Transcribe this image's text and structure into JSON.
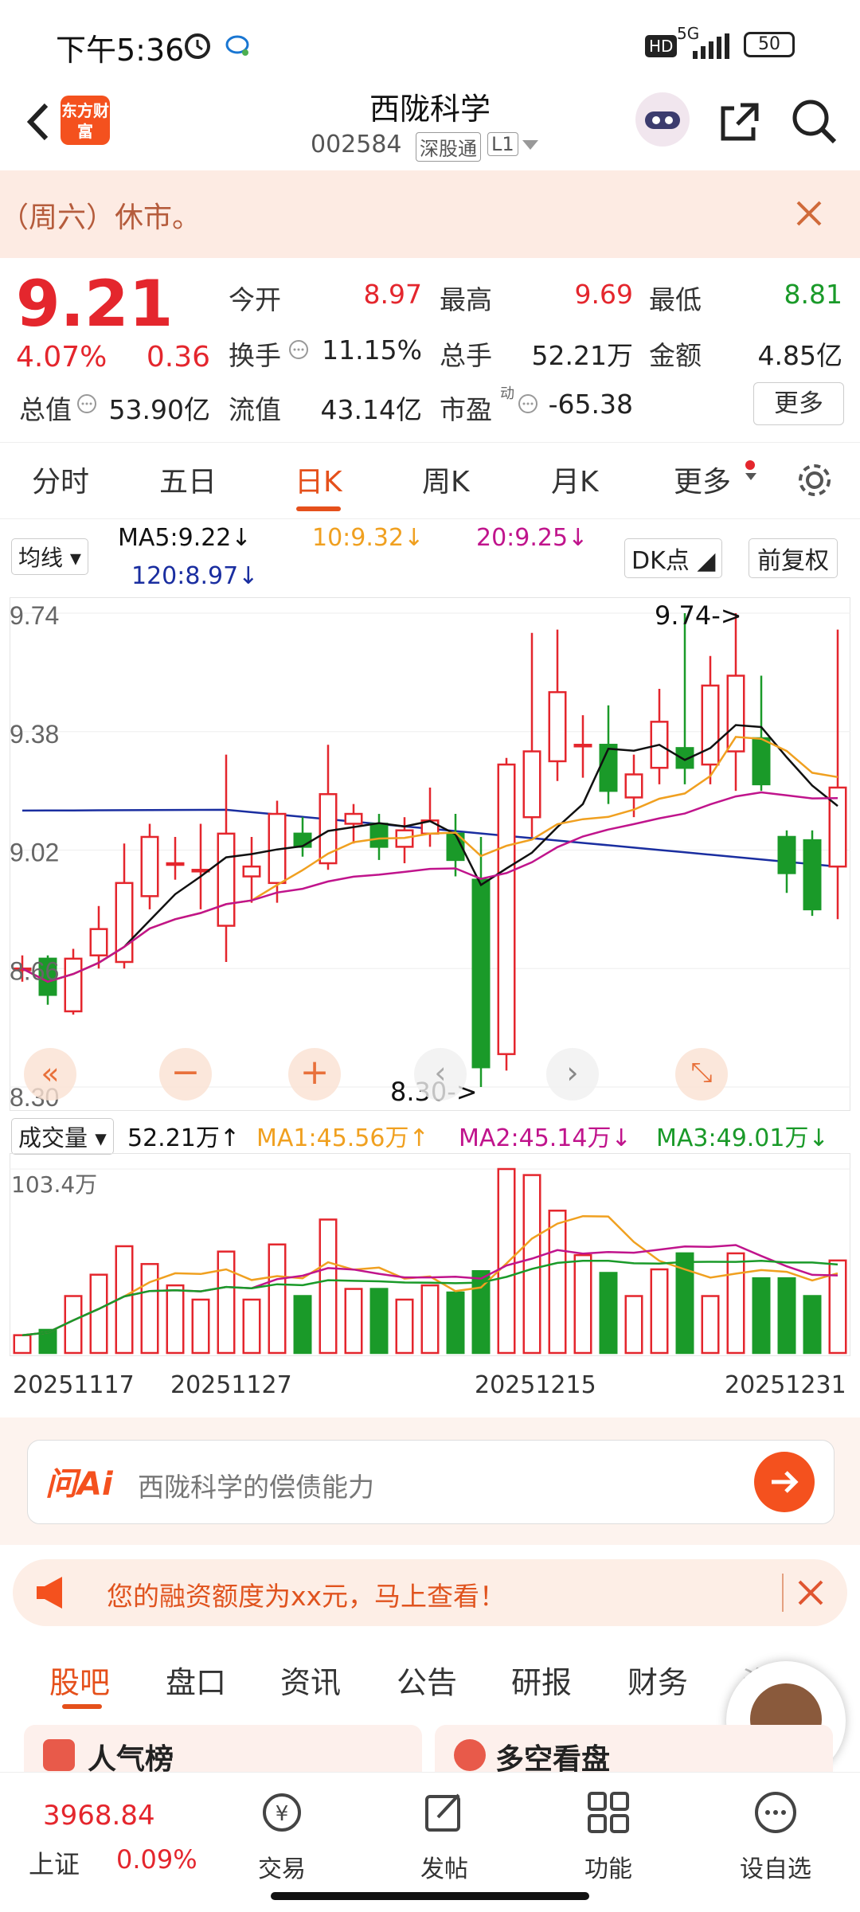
{
  "status_bar": {
    "time": "下午5:36",
    "network": "5G",
    "battery": "50",
    "hd": "HD"
  },
  "header": {
    "logo_text": "东方财富",
    "stock_name": "西陇科学",
    "stock_code": "002584",
    "tag1": "深股通",
    "tag2": "L1"
  },
  "notice": {
    "text": "（周六）休市。"
  },
  "quote": {
    "price": "9.21",
    "change_pct": "4.07%",
    "change_amt": "0.36",
    "open_label": "今开",
    "open": "8.97",
    "high_label": "最高",
    "high": "9.69",
    "low_label": "最低",
    "low": "8.81",
    "turnover_label": "换手",
    "turnover": "11.15%",
    "volume_label": "总手",
    "volume": "52.21万",
    "amount_label": "金额",
    "amount": "4.85亿",
    "mcap_label": "总值",
    "mcap": "53.90亿",
    "float_label": "流值",
    "float_cap": "43.14亿",
    "pe_label": "市盈",
    "pe_sup": "动",
    "pe": "-65.38",
    "more_button": "更多"
  },
  "tabs": [
    "分时",
    "五日",
    "日K",
    "周K",
    "月K",
    "更多"
  ],
  "active_tab": "日K",
  "chart_controls": {
    "ma_selector": "均线",
    "ma5": "MA5:9.22↓",
    "ma10": "10:9.32↓",
    "ma20": "20:9.25↓",
    "ma120": "120:8.97↓",
    "dk_button": "DK点",
    "adjust_button": "前复权",
    "volume_selector": "成交量",
    "vol_value": "52.21万↑",
    "vol_ma1": "MA1:45.56万↑",
    "vol_ma2": "MA2:45.14万↓",
    "vol_ma3": "MA3:49.01万↓",
    "vol_max_label": "103.4万",
    "high_marker": "9.74->",
    "low_marker": "8.30->"
  },
  "chart_data": {
    "type": "candlestick",
    "yticks": [
      "9.74",
      "9.38",
      "9.02",
      "8.66",
      "8.30"
    ],
    "ylim": [
      8.3,
      9.74
    ],
    "x_labels": [
      "20251117",
      "20251127",
      "20251215",
      "20251231"
    ],
    "candles": [
      {
        "o": 8.66,
        "c": 8.66,
        "h": 8.7,
        "l": 8.62,
        "v": 10
      },
      {
        "o": 8.69,
        "c": 8.58,
        "h": 8.7,
        "l": 8.55,
        "v": 13
      },
      {
        "o": 8.53,
        "c": 8.69,
        "h": 8.72,
        "l": 8.52,
        "v": 32
      },
      {
        "o": 8.7,
        "c": 8.78,
        "h": 8.85,
        "l": 8.66,
        "v": 44
      },
      {
        "o": 8.68,
        "c": 8.92,
        "h": 9.04,
        "l": 8.66,
        "v": 60
      },
      {
        "o": 8.88,
        "c": 9.06,
        "h": 9.1,
        "l": 8.84,
        "v": 50
      },
      {
        "o": 8.98,
        "c": 8.98,
        "h": 9.06,
        "l": 8.93,
        "v": 38
      },
      {
        "o": 8.96,
        "c": 8.96,
        "h": 9.1,
        "l": 8.84,
        "v": 30
      },
      {
        "o": 8.79,
        "c": 9.07,
        "h": 9.31,
        "l": 8.68,
        "v": 57
      },
      {
        "o": 8.94,
        "c": 8.97,
        "h": 9.06,
        "l": 8.86,
        "v": 30
      },
      {
        "o": 8.92,
        "c": 9.13,
        "h": 9.17,
        "l": 8.86,
        "v": 61
      },
      {
        "o": 9.07,
        "c": 9.03,
        "h": 9.12,
        "l": 9.0,
        "v": 32
      },
      {
        "o": 8.98,
        "c": 9.19,
        "h": 9.34,
        "l": 8.96,
        "v": 75
      },
      {
        "o": 9.1,
        "c": 9.13,
        "h": 9.16,
        "l": 9.04,
        "v": 36
      },
      {
        "o": 9.1,
        "c": 9.03,
        "h": 9.13,
        "l": 8.99,
        "v": 36
      },
      {
        "o": 9.03,
        "c": 9.08,
        "h": 9.12,
        "l": 8.98,
        "v": 30
      },
      {
        "o": 9.07,
        "c": 9.11,
        "h": 9.21,
        "l": 9.03,
        "v": 38
      },
      {
        "o": 9.07,
        "c": 8.99,
        "h": 9.13,
        "l": 8.94,
        "v": 34
      },
      {
        "o": 8.93,
        "c": 8.36,
        "h": 9.06,
        "l": 8.3,
        "v": 46
      },
      {
        "o": 8.4,
        "c": 9.28,
        "h": 9.3,
        "l": 8.35,
        "v": 103.4
      },
      {
        "o": 9.12,
        "c": 9.32,
        "h": 9.68,
        "l": 9.06,
        "v": 100
      },
      {
        "o": 9.29,
        "c": 9.5,
        "h": 9.69,
        "l": 9.23,
        "v": 80
      },
      {
        "o": 9.34,
        "c": 9.34,
        "h": 9.43,
        "l": 9.24,
        "v": 55
      },
      {
        "o": 9.34,
        "c": 9.2,
        "h": 9.46,
        "l": 9.16,
        "v": 45
      },
      {
        "o": 9.18,
        "c": 9.25,
        "h": 9.31,
        "l": 9.12,
        "v": 32
      },
      {
        "o": 9.27,
        "c": 9.41,
        "h": 9.51,
        "l": 9.22,
        "v": 47
      },
      {
        "o": 9.33,
        "c": 9.27,
        "h": 9.74,
        "l": 9.22,
        "v": 56
      },
      {
        "o": 9.28,
        "c": 9.52,
        "h": 9.61,
        "l": 9.22,
        "v": 32
      },
      {
        "o": 9.32,
        "c": 9.55,
        "h": 9.74,
        "l": 9.2,
        "v": 56
      },
      {
        "o": 9.36,
        "c": 9.22,
        "h": 9.55,
        "l": 9.2,
        "v": 42
      },
      {
        "o": 9.06,
        "c": 8.95,
        "h": 9.08,
        "l": 8.89,
        "v": 42
      },
      {
        "o": 9.05,
        "c": 8.84,
        "h": 9.08,
        "l": 8.82,
        "v": 32
      },
      {
        "o": 8.97,
        "c": 9.21,
        "h": 9.69,
        "l": 8.81,
        "v": 52
      }
    ]
  },
  "ai_bar": {
    "logo": "问Ai",
    "placeholder": "西陇科学的偿债能力"
  },
  "promo": {
    "text": "您的融资额度为xx元，马上查看！"
  },
  "sub_tabs": [
    "股吧",
    "盘口",
    "资讯",
    "公告",
    "研报",
    "财务",
    "资料"
  ],
  "active_sub_tab": "股吧",
  "cards": {
    "left": "人气榜",
    "right": "多空看盘"
  },
  "bottom_nav": {
    "index_value": "3968.84",
    "index_name": "上证",
    "index_change": "0.09%",
    "items": [
      "交易",
      "发帖",
      "功能",
      "设自选"
    ]
  }
}
